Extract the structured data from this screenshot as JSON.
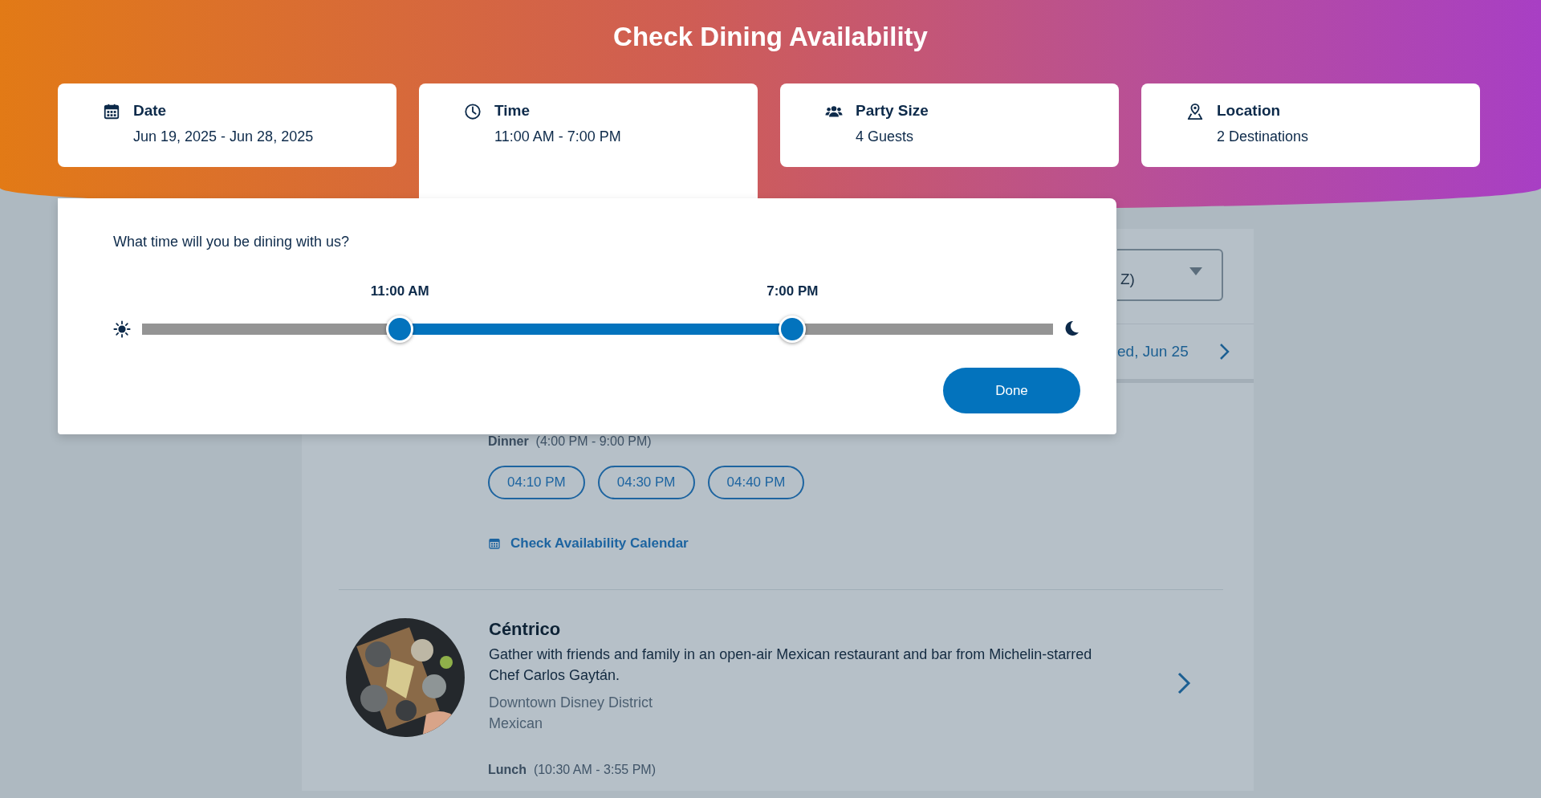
{
  "header": {
    "title": "Check Dining Availability"
  },
  "filters": [
    {
      "kind": "date",
      "label": "Date",
      "value": "Jun 19, 2025 - Jun 28, 2025",
      "selected": false
    },
    {
      "kind": "time",
      "label": "Time",
      "value": "11:00 AM - 7:00 PM",
      "selected": true
    },
    {
      "kind": "party",
      "label": "Party Size",
      "value": "4 Guests",
      "selected": false
    },
    {
      "kind": "location",
      "label": "Location",
      "value": "2 Destinations",
      "selected": false
    }
  ],
  "time_panel": {
    "question": "What time will you be dining with us?",
    "thumbs": [
      {
        "label": "11:00 AM",
        "level": 0.283
      },
      {
        "label": "7:00 PM",
        "level": 0.714
      }
    ],
    "done_button": "Done"
  },
  "sort_dropdown": {
    "value": "Z)"
  },
  "date_nav": {
    "label": "ed, Jun 25"
  },
  "restaurants": [
    {
      "meals": [
        {
          "name": "Dinner",
          "hours": "(4:00 PM - 9:00 PM)",
          "times": [
            "04:10 PM",
            "04:30 PM",
            "04:40 PM"
          ]
        }
      ],
      "calendar_link": "Check Availability Calendar"
    },
    {
      "name": "Céntrico",
      "description": "Gather with friends and family in an open-air Mexican restaurant and bar from Michelin-starred Chef Carlos Gaytán.",
      "location": "Downtown Disney District",
      "cuisine": "Mexican",
      "meals": [
        {
          "name": "Lunch",
          "hours": "(10:30 AM - 3:55 PM)"
        }
      ]
    }
  ]
}
